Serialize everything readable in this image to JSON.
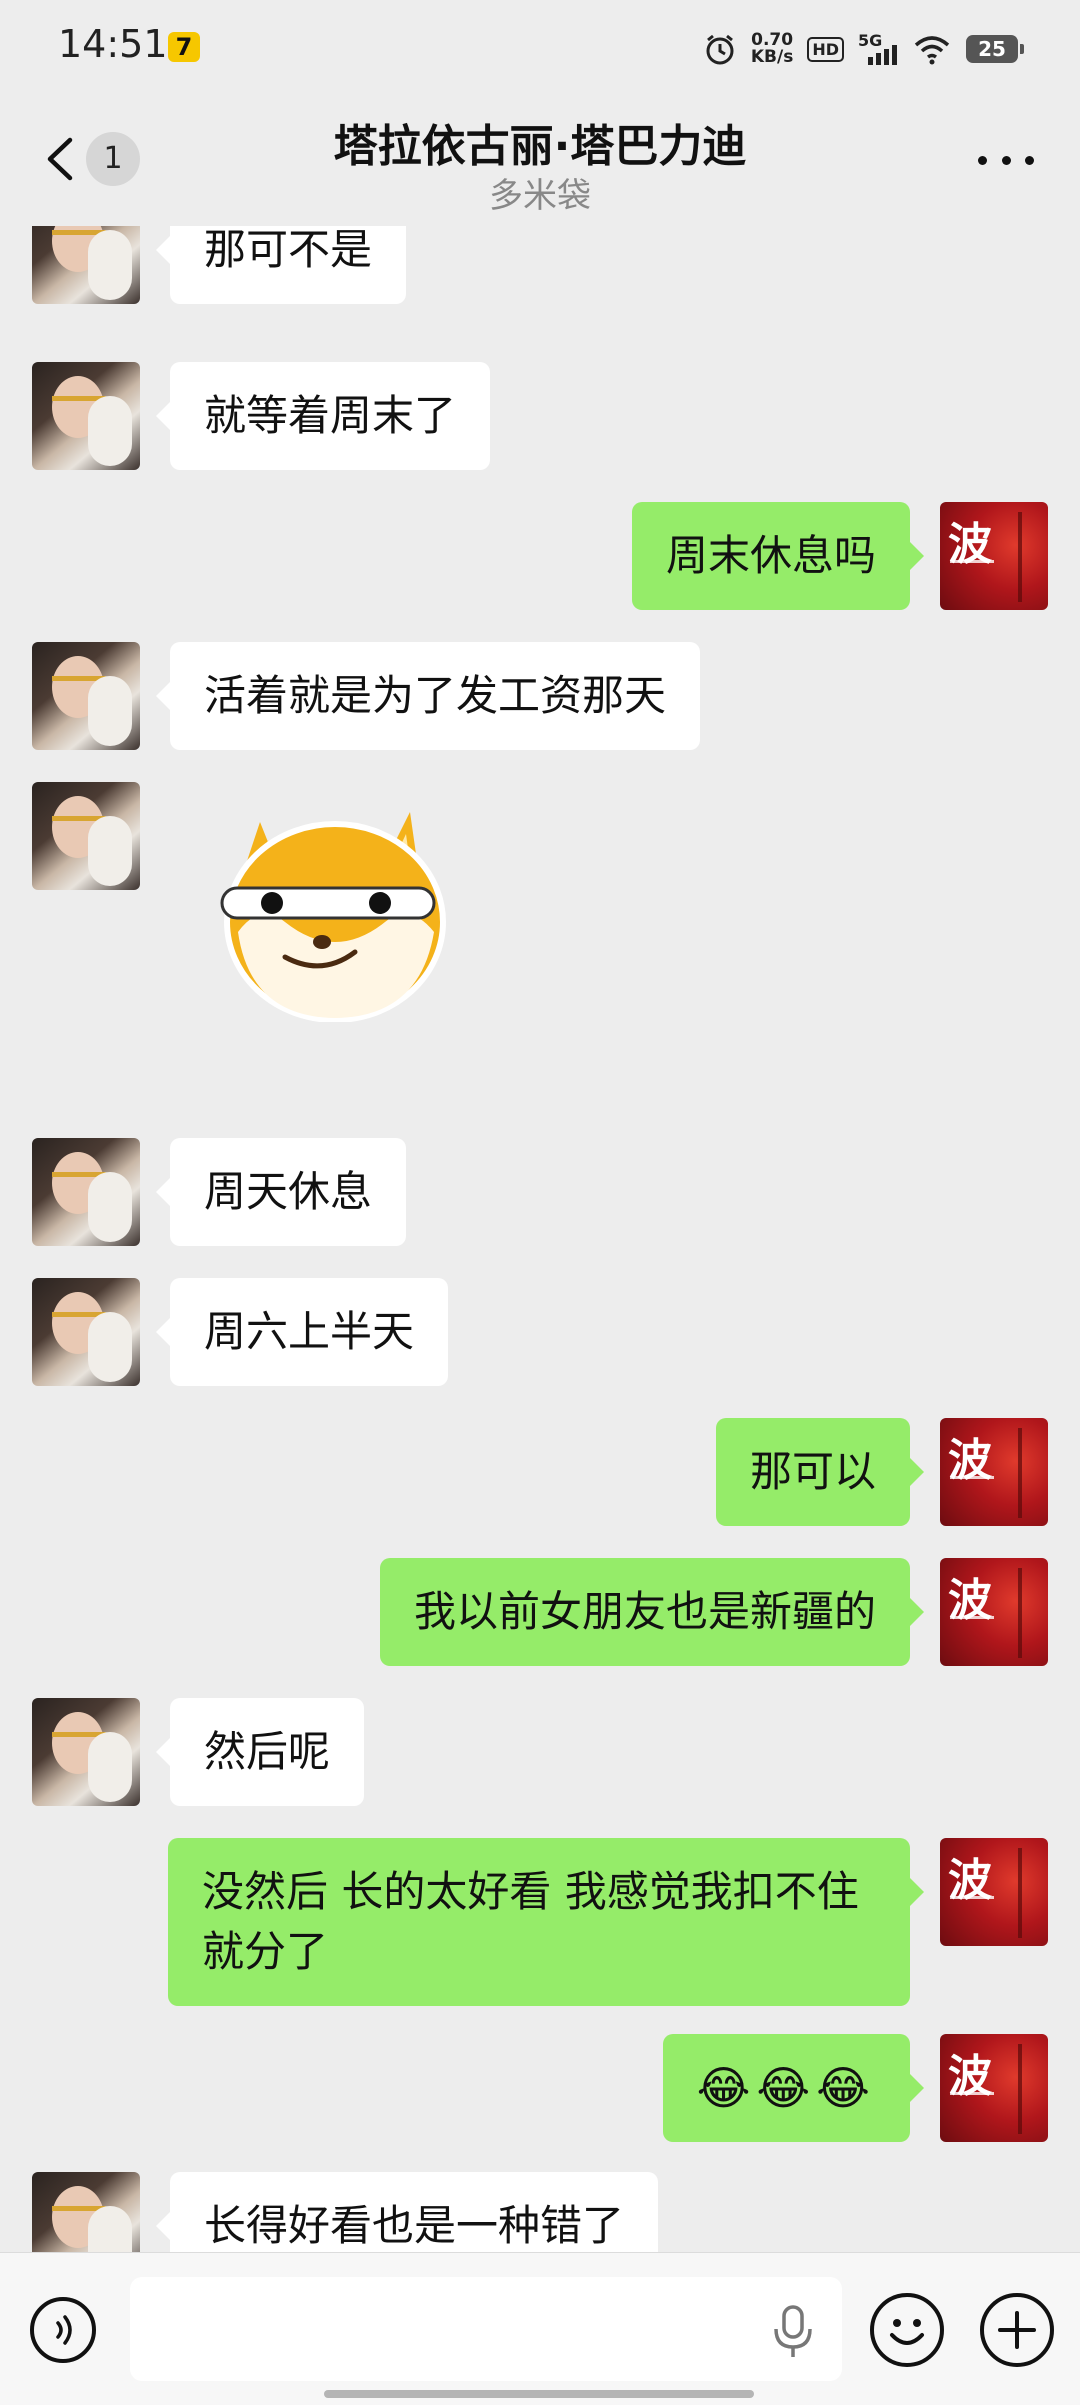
{
  "status_bar": {
    "time": "14:51",
    "net_speed_value": "0.70",
    "net_speed_unit": "KB/s",
    "hd": "HD",
    "network": "5G",
    "battery": "25"
  },
  "header": {
    "unread_count": "1",
    "title": "塔拉依古丽·塔巴力迪",
    "subtitle": "多米袋"
  },
  "messages": [
    {
      "side": "left",
      "text": "那可不是"
    },
    {
      "side": "left",
      "text": "就等着周末了"
    },
    {
      "side": "right",
      "text": "周末休息吗"
    },
    {
      "side": "left",
      "text": "活着就是为了发工资那天"
    },
    {
      "side": "left",
      "type": "sticker",
      "sticker": "shiba-dog-side-eye"
    },
    {
      "side": "left",
      "text": "周天休息"
    },
    {
      "side": "left",
      "text": "周六上半天"
    },
    {
      "side": "right",
      "text": "那可以"
    },
    {
      "side": "right",
      "text": "我以前女朋友也是新疆的"
    },
    {
      "side": "left",
      "text": "然后呢"
    },
    {
      "side": "right",
      "text": "没然后 长的太好看 我感觉我扣不住 就分了"
    },
    {
      "side": "right",
      "text": "😂😂😂"
    },
    {
      "side": "left",
      "text": "长得好看也是一种错了"
    }
  ],
  "avatars": {
    "right_text": "波"
  },
  "input_bar": {
    "placeholder": ""
  }
}
